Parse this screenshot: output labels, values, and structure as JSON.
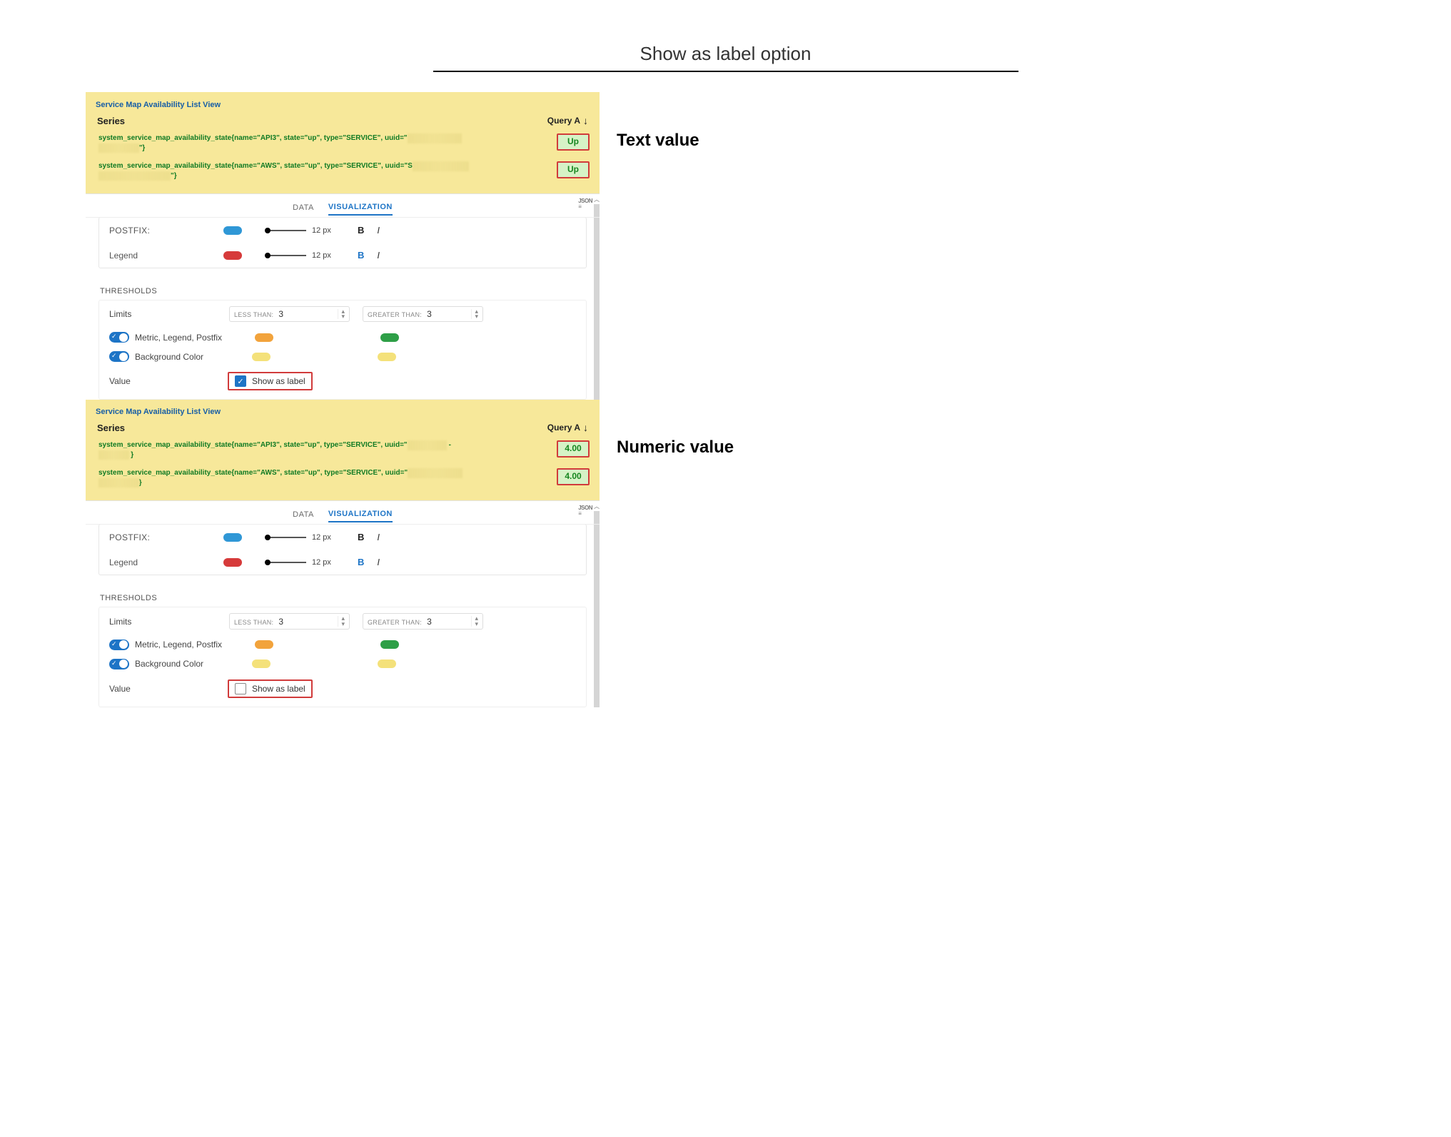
{
  "page": {
    "title": "Show as label option"
  },
  "captions": {
    "text_value": "Text value",
    "numeric_value": "Numeric value"
  },
  "panel": {
    "title": "Service Map Availability List View",
    "series_label": "Series",
    "query_tag": "Query A",
    "tabs": {
      "data": "DATA",
      "visualization": "VISUALIZATION"
    },
    "json_icon": "JSON",
    "rows_top": {
      "postfix_label": "POSTFIX:",
      "legend_label": "Legend",
      "size_px": "12 px",
      "bold": "B",
      "italic": "I"
    },
    "thresholds": {
      "heading": "THRESHOLDS",
      "limits_label": "Limits",
      "less_than_label": "LESS THAN:",
      "less_than_value": "3",
      "greater_than_label": "GREATER THAN:",
      "greater_than_value": "3",
      "metric_legend_postfix": "Metric, Legend, Postfix",
      "background_color": "Background Color",
      "value_label": "Value",
      "show_as_label": "Show as label"
    }
  },
  "series_text": [
    {
      "name": "system_service_map_availability_state{name=\"API3\", state=\"up\", type=\"SERVICE\", uuid=\"",
      "value": "Up"
    },
    {
      "name": "system_service_map_availability_state{name=\"AWS\", state=\"up\", type=\"SERVICE\", uuid=\"S",
      "value": "Up"
    }
  ],
  "series_numeric": [
    {
      "name": "system_service_map_availability_state{name=\"API3\", state=\"up\", type=\"SERVICE\", uuid=\"",
      "value": "4.00"
    },
    {
      "name": "system_service_map_availability_state{name=\"AWS\", state=\"up\", type=\"SERVICE\", uuid=\"",
      "value": "4.00"
    }
  ],
  "colors": {
    "postfix": "#2f97d6",
    "legend": "#d63a3a",
    "th_low_left": "#f2a33c",
    "th_low_right": "#2e9f47",
    "th_bg_left": "#f4e17a",
    "th_bg_right": "#f4e17a"
  }
}
